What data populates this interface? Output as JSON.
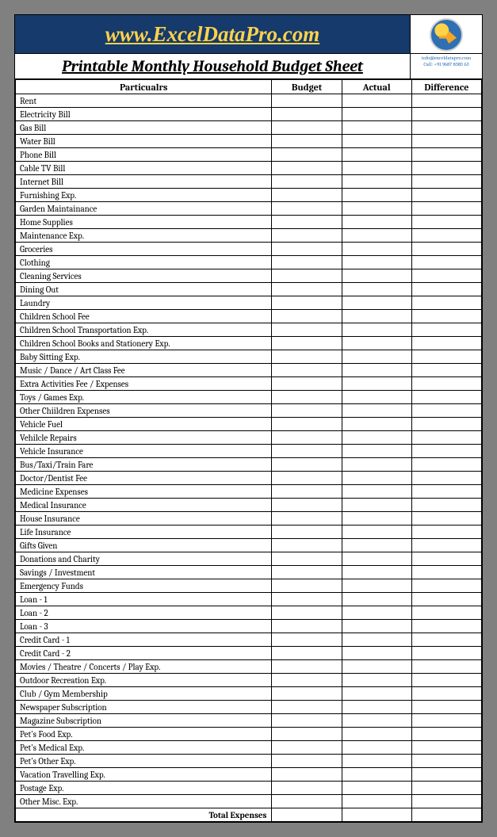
{
  "banner": {
    "url_text": "www.ExcelDataPro.com",
    "contact_email": "info@exceldatapro.com",
    "contact_phone": "Call: +91 9687 8585 63"
  },
  "title": "Printable Monthly Household Budget Sheet",
  "columns": {
    "particulars": "Particualrs",
    "budget": "Budget",
    "actual": "Actual",
    "difference": "Difference"
  },
  "rows": [
    "Rent",
    "Electricity Bill",
    "Gas Bill",
    "Water Bill",
    "Phone Bill",
    "Cable TV Bill",
    "Internet Bill",
    "Furnishing Exp.",
    "Garden Maintainance",
    "Home Supplies",
    "Maintenance Exp.",
    "Groceries",
    "Clothing",
    "Cleaning Services",
    "Dining Out",
    "Laundry",
    "Children School Fee",
    "Children School Transportation Exp.",
    "Children School Books and Stationery Exp.",
    "Baby Sitting Exp.",
    "Music / Dance / Art Class Fee",
    "Extra Activities Fee / Expenses",
    "Toys / Games Exp.",
    "Other Chiildren Expenses",
    "Vehicle Fuel",
    "Vehilcle Repairs",
    "Vehicle Insurance",
    "Bus/Taxi/Train Fare",
    "Doctor/Dentist Fee",
    "Medicine Expenses",
    "Medical Insurance",
    "House Insurance",
    "Life Insurance",
    "Gifts Given",
    "Donations and Charity",
    "Savings / Investment",
    "Emergency Funds",
    "Loan - 1",
    "Loan - 2",
    "Loan - 3",
    "Credit Card - 1",
    "Credit Card - 2",
    "Movies / Theatre / Concerts / Play Exp.",
    "Outdoor Recreation Exp.",
    "Club / Gym Membership",
    "Newspaper Subscription",
    "Magazine Subscription",
    "Pet's Food Exp.",
    "Pet's Medical Exp.",
    "Pet's Other Exp.",
    "Vacation Travelling Exp.",
    "Postage Exp.",
    "Other Misc. Exp."
  ],
  "total_label": "Total Expenses"
}
